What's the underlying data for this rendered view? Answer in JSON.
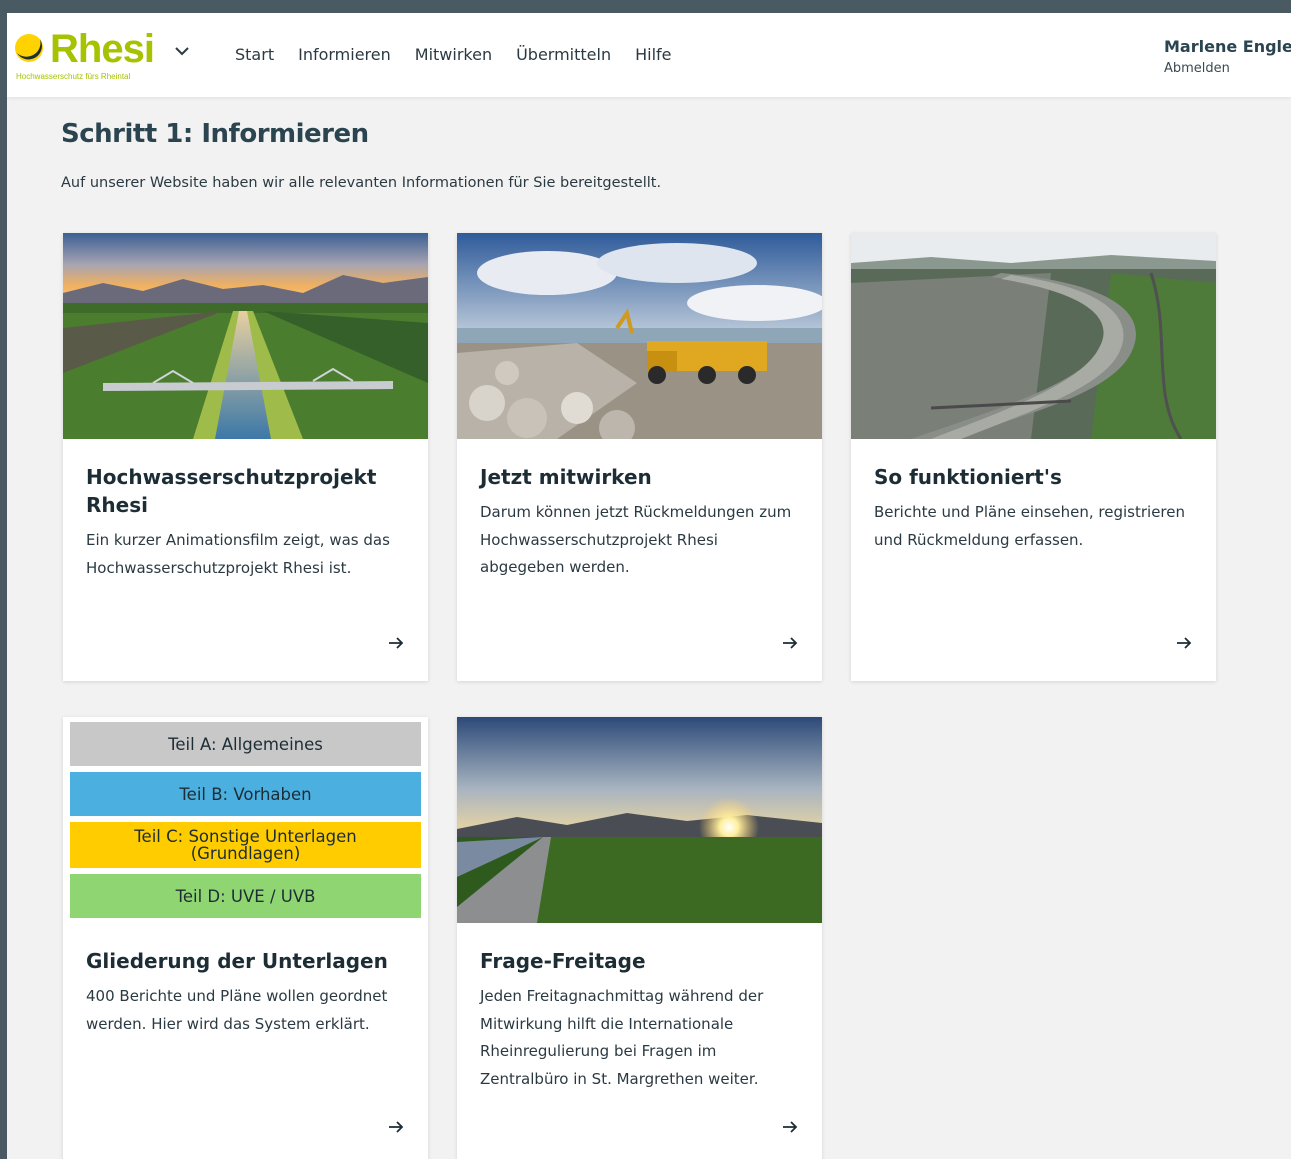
{
  "header": {
    "logo": {
      "name": "Rhesi",
      "tagline": "Hochwasserschutz fürs Rheintal",
      "brand_color": "#a6c200"
    },
    "nav": [
      {
        "label": "Start",
        "active": false
      },
      {
        "label": "Informieren",
        "active": true
      },
      {
        "label": "Mitwirken",
        "active": false
      },
      {
        "label": "Übermitteln",
        "active": false
      },
      {
        "label": "Hilfe",
        "active": false
      }
    ],
    "user": {
      "name": "Marlene Engler",
      "logout_label": "Abmelden"
    }
  },
  "main": {
    "title": "Schritt 1: Informieren",
    "intro": "Auf unserer Website haben wir alle relevanten Informationen für Sie bereitgestellt.",
    "cards": [
      {
        "title": "Hochwasserschutzprojekt Rhesi",
        "text": "Ein kurzer Animationsfilm zeigt, was das Hochwasserschutzprojekt Rhesi ist.",
        "image": "aerial-river-sunset-photo",
        "link_icon": "arrow-right-icon"
      },
      {
        "title": "Jetzt mitwirken",
        "text": "Darum können jetzt Rückmeldungen zum Hochwasserschutzprojekt Rhesi abgegeben werden.",
        "image": "construction-truck-rocks-photo",
        "link_icon": "arrow-right-icon"
      },
      {
        "title": "So funktioniert's",
        "text": "Berichte und Pläne einsehen, registrieren und Rückmeldung erfassen.",
        "image": "aerial-river-town-photo",
        "link_icon": "arrow-right-icon"
      },
      {
        "title": "Gliederung der Unterlagen",
        "text": "400 Berichte und Pläne wollen geordnet werden. Hier wird das System erklärt.",
        "parts": [
          {
            "label": "Teil A: Allgemeines",
            "color": "#c8c8c8"
          },
          {
            "label": "Teil B: Vorhaben",
            "color": "#4bb0e0"
          },
          {
            "label": "Teil C: Sonstige Unterlagen (Grundlagen)",
            "color": "#ffcc00"
          },
          {
            "label": "Teil D: UVE / UVB",
            "color": "#8fd672"
          }
        ],
        "link_icon": "arrow-right-icon"
      },
      {
        "title": "Frage-Freitage",
        "text": "Jeden Freitagnachmittag während der Mitwirkung hilft die Internationale Rheinregulierung bei Fragen im Zentralbüro in St. Margrethen weiter.",
        "image": "sunset-field-road-photo",
        "link_icon": "arrow-right-icon"
      }
    ]
  }
}
